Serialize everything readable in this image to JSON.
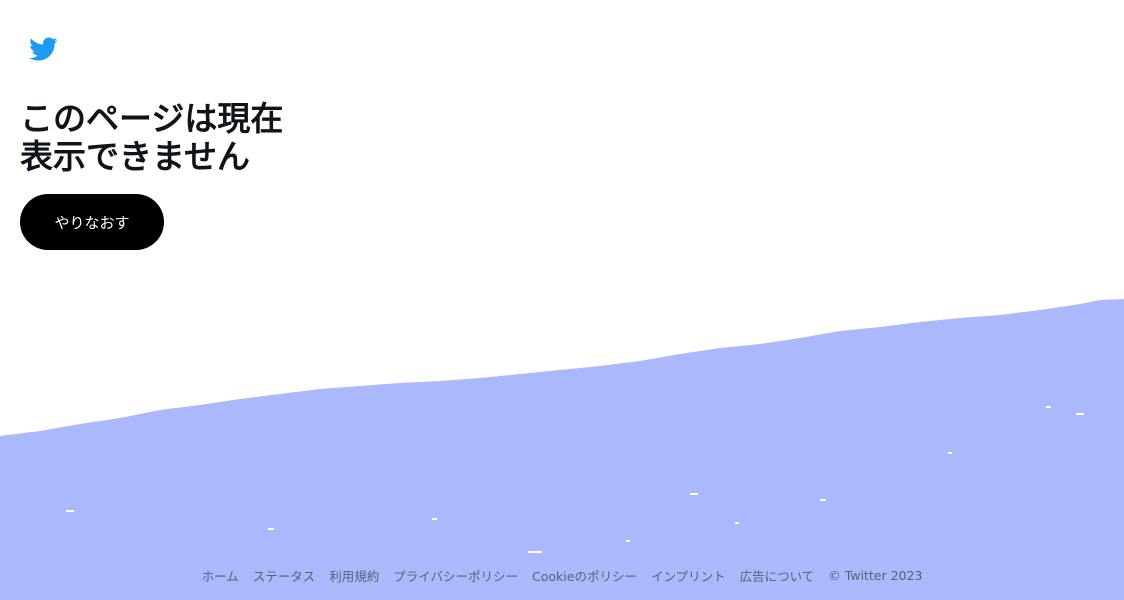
{
  "brand": {
    "logo_icon": "twitter-bird-icon",
    "logo_color": "#1d9bf0"
  },
  "error": {
    "title": "このページは現在\n表示できません",
    "retry_label": "やりなおす"
  },
  "background": {
    "wave_color": "#abb8fb"
  },
  "footer": {
    "links": [
      "ホーム",
      "ステータス",
      "利用規約",
      "プライバシーポリシー",
      "Cookieのポリシー",
      "インプリント",
      "広告について"
    ],
    "copyright": "© Twitter 2023"
  }
}
